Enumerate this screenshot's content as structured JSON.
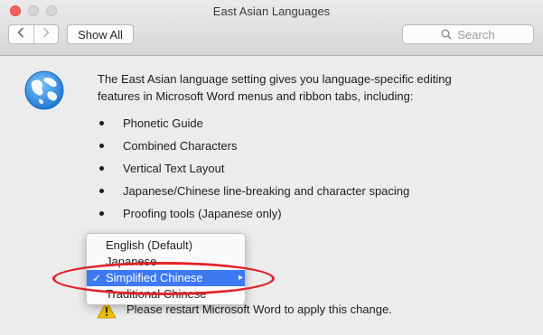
{
  "window": {
    "title": "East Asian Languages"
  },
  "toolbar": {
    "back_icon": "chevron-left-icon",
    "forward_icon": "chevron-right-icon",
    "show_all_label": "Show All",
    "search_placeholder": "Search"
  },
  "content": {
    "icon": "globe-icon",
    "description": "The East Asian language setting gives you language-specific editing features in Microsoft Word menus and ribbon tabs, including:",
    "features": [
      "Phonetic Guide",
      "Combined Characters",
      "Vertical Text Layout",
      "Japanese/Chinese line-breaking and character spacing",
      "Proofing tools (Japanese only)"
    ],
    "restart_notice": "Please restart Microsoft Word to apply this change."
  },
  "language_menu": {
    "options": [
      "English (Default)",
      "Japanese",
      "Simplified Chinese",
      "Traditional Chinese"
    ],
    "selected": "Simplified Chinese",
    "check_mark": "✓",
    "accent_color": "#3c79f2"
  },
  "annotation": {
    "color": "#e1242b"
  }
}
